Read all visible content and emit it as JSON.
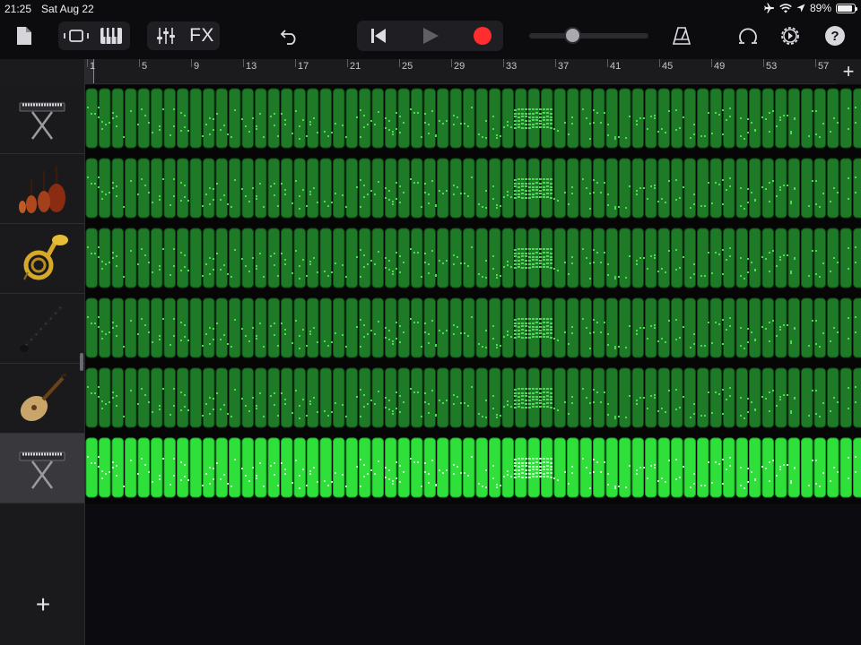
{
  "status_bar": {
    "time": "21:25",
    "date": "Sat Aug 22",
    "battery_percent": "89%",
    "battery_level": 0.89,
    "icons": [
      "airplane-icon",
      "wifi-icon",
      "location-icon",
      "battery-icon"
    ]
  },
  "toolbar": {
    "buttons": [
      {
        "name": "my-songs-button",
        "icon": "document-icon"
      },
      {
        "name": "tracks-view-button",
        "icon": "tracks-view-icon"
      },
      {
        "name": "instrument-view-button",
        "icon": "piano-keys-icon"
      },
      {
        "name": "mixer-button",
        "icon": "sliders-icon"
      },
      {
        "name": "fx-button",
        "label": "FX"
      },
      {
        "name": "undo-button",
        "icon": "undo-icon"
      },
      {
        "name": "go-to-beginning-button",
        "icon": "skip-back-icon"
      },
      {
        "name": "play-button",
        "icon": "play-icon"
      },
      {
        "name": "record-button",
        "icon": "record-icon"
      },
      {
        "name": "metronome-button",
        "icon": "metronome-icon"
      },
      {
        "name": "loop-browser-button",
        "icon": "loop-icon"
      },
      {
        "name": "settings-button",
        "icon": "gear-icon"
      },
      {
        "name": "help-button",
        "label": "?"
      }
    ],
    "fx_label": "FX",
    "help_label": "?",
    "volume_level": 0.36,
    "colors": {
      "record": "#ff2d2d",
      "toolbar_bg": "#0c0c0e",
      "pill_bg": "#1f1f23"
    }
  },
  "ruler": {
    "bar_labels": [
      "1",
      "5",
      "9",
      "13",
      "17",
      "21",
      "25",
      "29",
      "33",
      "37",
      "41",
      "45",
      "49",
      "53",
      "57"
    ],
    "add_section_label": "+"
  },
  "tracks": [
    {
      "instrument": "keyboard",
      "icon": "keyboard-stand-icon",
      "selected": false
    },
    {
      "instrument": "strings",
      "icon": "violin-cello-icon",
      "selected": false
    },
    {
      "instrument": "french horn",
      "icon": "french-horn-icon",
      "selected": false
    },
    {
      "instrument": "clarinet",
      "icon": "clarinet-icon",
      "selected": false
    },
    {
      "instrument": "lute",
      "icon": "lute-icon",
      "selected": false
    },
    {
      "instrument": "keyboard",
      "icon": "keyboard-stand-icon",
      "selected": true
    }
  ],
  "region_colors": {
    "normal": "#1f7a28",
    "normal_border": "#0f4d16",
    "note": "#4ddb55",
    "selected": "#2fe03a",
    "selected_note": "#c8f5c8"
  },
  "add_track_label": "+"
}
